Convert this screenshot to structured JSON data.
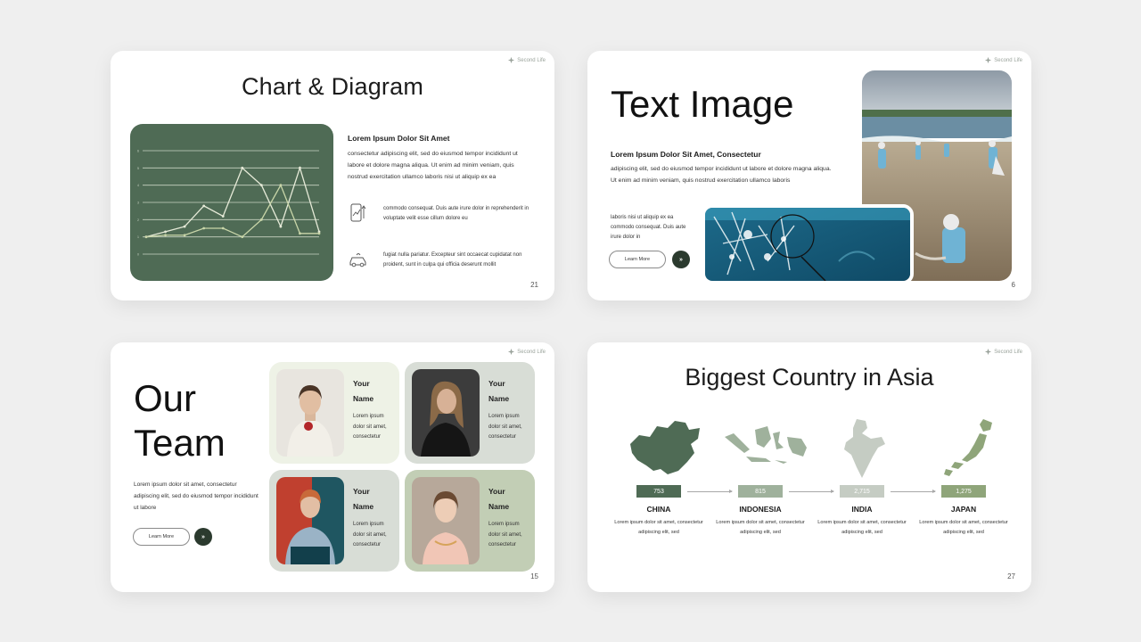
{
  "brand": "Second Life",
  "slides": {
    "chart": {
      "title": "Chart & Diagram",
      "heading": "Lorem Ipsum Dolor Sit Amet",
      "paragraph": "consectetur adipiscing elit, sed do eiusmod tempor incididunt ut labore et dolore magna aliqua. Ut enim ad minim veniam, quis nostrud exercitation ullamco laboris nisi ut aliquip ex ea",
      "feature1": "commodo consequat. Duis aute irure dolor in reprehenderit in voluptate velit esse cillum dolore eu",
      "feature2": "fugiat nulla pariatur. Excepteur sint occaecat cupidatat non proident, sunt in culpa qui officia deserunt mollit",
      "page": "21",
      "icons": [
        "phone-chart-icon",
        "car-icon"
      ]
    },
    "text_image": {
      "title": "Text Image",
      "heading": "Lorem Ipsum Dolor Sit Amet, Consectetur",
      "paragraph": "adipiscing elit, sed do eiusmod tempor incididunt ut labore et dolore magna aliqua. Ut enim ad minim veniam, quis nostrud exercitation ullamco laboris",
      "paragraph2": "laboris nisi ut aliquip ex ea commodo consequat. Duis aute irure dolor in",
      "button": "Learn More",
      "arrow": "»",
      "page": "6"
    },
    "team": {
      "title_line1": "Our",
      "title_line2": "Team",
      "paragraph": "Lorem ipsum dolor sit amet, consectetur adipiscing elit, sed do eiusmod tempor incididunt ut labore",
      "button": "Learn More",
      "arrow": "»",
      "page": "15",
      "members": [
        {
          "name_line1": "Your",
          "name_line2": "Name",
          "desc": "Lorem ipsum dolor sit amet, consectetur"
        },
        {
          "name_line1": "Your",
          "name_line2": "Name",
          "desc": "Lorem ipsum dolor sit amet, consectetur"
        },
        {
          "name_line1": "Your",
          "name_line2": "Name",
          "desc": "Lorem ipsum dolor sit amet, consectetur"
        },
        {
          "name_line1": "Your",
          "name_line2": "Name",
          "desc": "Lorem ipsum dolor sit amet, consectetur"
        }
      ]
    },
    "asia": {
      "title": "Biggest Country in Asia",
      "page": "27",
      "countries": [
        {
          "name": "CHINA",
          "value": "753",
          "desc": "Lorem ipsum dolor sit amet, consectetur adipiscing elit, sed",
          "color": "#4f6b55"
        },
        {
          "name": "INDONESIA",
          "value": "815",
          "desc": "Lorem ipsum dolor sit amet, consectetur adipiscing elit, sed",
          "color": "#9fb19c"
        },
        {
          "name": "INDIA",
          "value": "2,715",
          "desc": "Lorem ipsum dolor sit amet, consectetur adipiscing elit, sed",
          "color": "#c5ccc3"
        },
        {
          "name": "JAPAN",
          "value": "1,275",
          "desc": "Lorem ipsum dolor sit amet, consectetur adipiscing elit, sed",
          "color": "#8fa57a"
        }
      ]
    }
  },
  "chart_data": {
    "type": "line",
    "x": [
      1,
      2,
      3,
      4,
      5,
      6,
      7,
      8,
      9,
      10
    ],
    "series": [
      {
        "values": [
          1,
          1.3,
          1.6,
          2.8,
          2.2,
          5,
          4,
          1.6,
          5,
          1.3
        ]
      },
      {
        "values": [
          1,
          1.1,
          1.1,
          1.5,
          1.5,
          1,
          2,
          4,
          1.2,
          1.2
        ]
      }
    ],
    "ylim": [
      0,
      6
    ],
    "grid": true,
    "colors": [
      "#e6ead8",
      "#c9d6a9"
    ]
  }
}
